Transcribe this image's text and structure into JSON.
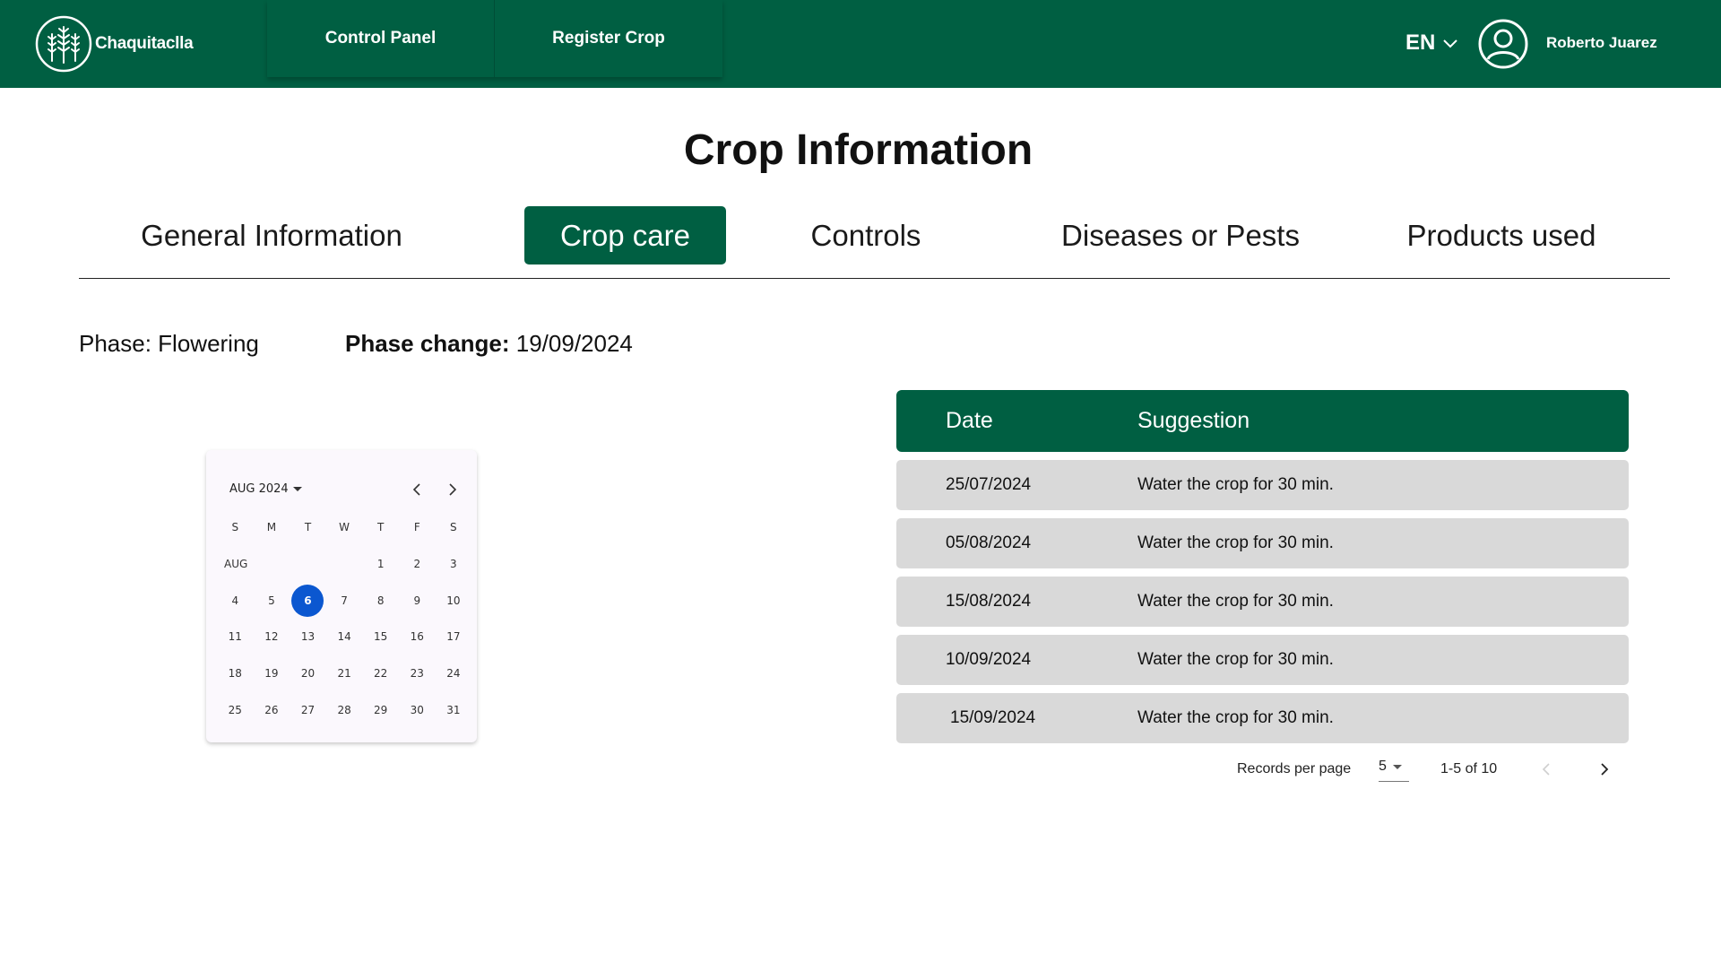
{
  "header": {
    "brand": "Chaquitaclla",
    "nav": [
      {
        "label": "Control Panel"
      },
      {
        "label": "Register Crop"
      }
    ],
    "language": "EN",
    "user_name": "Roberto Juarez",
    "colors": {
      "primary": "#005f42",
      "accent": "#0b57d0"
    }
  },
  "page": {
    "title": "Crop Information"
  },
  "tabs": [
    {
      "label": "General Information",
      "active": false
    },
    {
      "label": "Crop care",
      "active": true
    },
    {
      "label": "Controls",
      "active": false
    },
    {
      "label": "Diseases or Pests",
      "active": false
    },
    {
      "label": "Products used",
      "active": false
    }
  ],
  "phase": {
    "text": "Phase: Flowering",
    "change_label": "Phase change:",
    "change_value": "19/09/2024"
  },
  "calendar": {
    "header": "AUG 2024",
    "month_label": "AUG",
    "weekdays": [
      "S",
      "M",
      "T",
      "W",
      "T",
      "F",
      "S"
    ],
    "first_weekday_index": 4,
    "days_in_month": 31,
    "selected_day": 6,
    "icons": {
      "dropdown": "caret-down-icon",
      "prev": "chevron-left-icon",
      "next": "chevron-right-icon"
    }
  },
  "table": {
    "columns": [
      "Date",
      "Suggestion"
    ],
    "rows": [
      {
        "date": "25/07/2024",
        "suggestion": "Water the crop for 30 min."
      },
      {
        "date": "05/08/2024",
        "suggestion": "Water the crop for 30 min."
      },
      {
        "date": "15/08/2024",
        "suggestion": "Water the crop for 30 min."
      },
      {
        "date": "10/09/2024",
        "suggestion": "Water the crop for 30 min."
      },
      {
        "date": "15/09/2024",
        "suggestion": "Water the crop for 30 min."
      }
    ]
  },
  "pagination": {
    "records_label": "Records per page",
    "per_page": "5",
    "range": "1-5 of 10"
  }
}
